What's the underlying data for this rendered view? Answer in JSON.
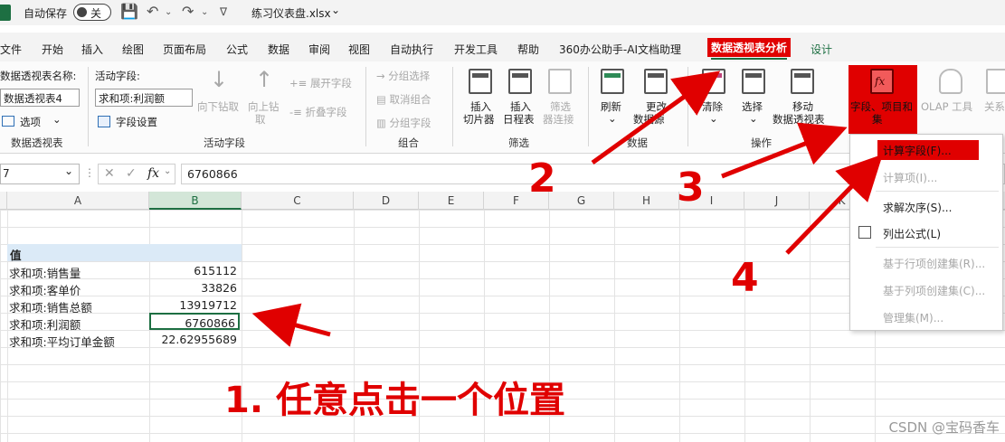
{
  "titlebar": {
    "autosave_label": "自动保存",
    "autosave_state": "关",
    "file_name": "练习仪表盘.xlsx"
  },
  "menu": {
    "tabs": [
      "文件",
      "开始",
      "插入",
      "绘图",
      "页面布局",
      "公式",
      "数据",
      "审阅",
      "视图",
      "自动执行",
      "开发工具",
      "帮助",
      "360办公助手-AI文档助理",
      "数据透视表分析",
      "设计"
    ],
    "active_tab": "数据透视表分析"
  },
  "ribbon": {
    "pivot_name_label": "数据透视表名称:",
    "pivot_name_value": "数据透视表4",
    "options_label": "选项",
    "group_pivot": "数据透视表",
    "active_field_label": "活动字段:",
    "active_field_value": "求和项:利润额",
    "field_settings": "字段设置",
    "drill_down": "向下钻取",
    "drill_up_1": "向上钻",
    "drill_up_2": "取",
    "expand_field": "展开字段",
    "collapse_field": "折叠字段",
    "group_active_field": "活动字段",
    "group_selection": "分组选择",
    "ungroup": "取消组合",
    "group_field": "分组字段",
    "group_group": "组合",
    "insert_slicer_1": "插入",
    "insert_slicer_2": "切片器",
    "insert_timeline_1": "插入",
    "insert_timeline_2": "日程表",
    "filter_conn_1": "筛选",
    "filter_conn_2": "器连接",
    "group_filter": "筛选",
    "refresh": "刷新",
    "change_source_1": "更改",
    "change_source_2": "数据源",
    "group_data": "数据",
    "clear": "清除",
    "select": "选择",
    "move_1": "移动",
    "move_2": "数据透视表",
    "group_actions": "操作",
    "fields_items_1": "字段、项目和",
    "fields_items_2": "集",
    "olap_tools": "OLAP 工具",
    "relations": "关系"
  },
  "formula_bar": {
    "name_box": "7",
    "fx": "fx",
    "formula": "6760866"
  },
  "columns": [
    "A",
    "B",
    "C",
    "D",
    "E",
    "F",
    "G",
    "H",
    "I",
    "J",
    "K"
  ],
  "pivot": {
    "header": "值",
    "rows": [
      {
        "label": "求和项:销售量",
        "value": "615112"
      },
      {
        "label": "求和项:客单价",
        "value": "33826"
      },
      {
        "label": "求和项:销售总额",
        "value": "13919712"
      },
      {
        "label": "求和项:利润额",
        "value": "6760866"
      },
      {
        "label": "求和项:平均订单金额",
        "value": "22.62955689"
      }
    ]
  },
  "dropdown": {
    "items": [
      "计算字段(F)...",
      "计算项(I)...",
      "求解次序(S)...",
      "列出公式(L)",
      "基于行项创建集(R)...",
      "基于列项创建集(C)...",
      "管理集(M)..."
    ]
  },
  "annotations": {
    "step1": "1. 任意点击一个位置",
    "step2": "2",
    "step3": "3",
    "step4": "4",
    "color": "#e00000"
  },
  "watermark": "CSDN @宝码香车"
}
